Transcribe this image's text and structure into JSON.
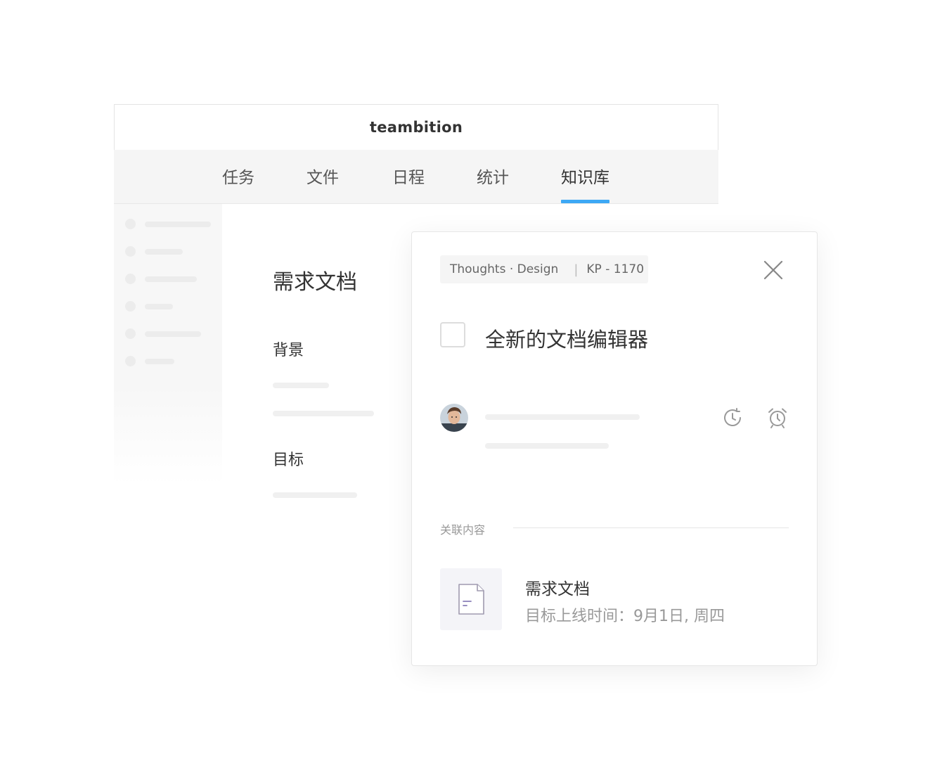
{
  "app": {
    "logo": "teambition",
    "nav": [
      {
        "label": "任务",
        "active": false
      },
      {
        "label": "文件",
        "active": false
      },
      {
        "label": "日程",
        "active": false
      },
      {
        "label": "统计",
        "active": false
      },
      {
        "label": "知识库",
        "active": true
      }
    ],
    "accent_color": "#3da8f5"
  },
  "document": {
    "title": "需求文档",
    "sections": [
      "背景",
      "目标"
    ]
  },
  "card": {
    "breadcrumb": {
      "project": "Thoughts · Design",
      "separator": "|",
      "id": "KP - 1170"
    },
    "task_title": "全新的文档编辑器",
    "icons": [
      "close-icon",
      "checkbox",
      "avatar",
      "history-icon",
      "alarm-icon",
      "document-icon"
    ],
    "related_label": "关联内容",
    "related_item": {
      "title": "需求文档",
      "subtitle": "目标上线时间：9月1日, 周四"
    }
  }
}
